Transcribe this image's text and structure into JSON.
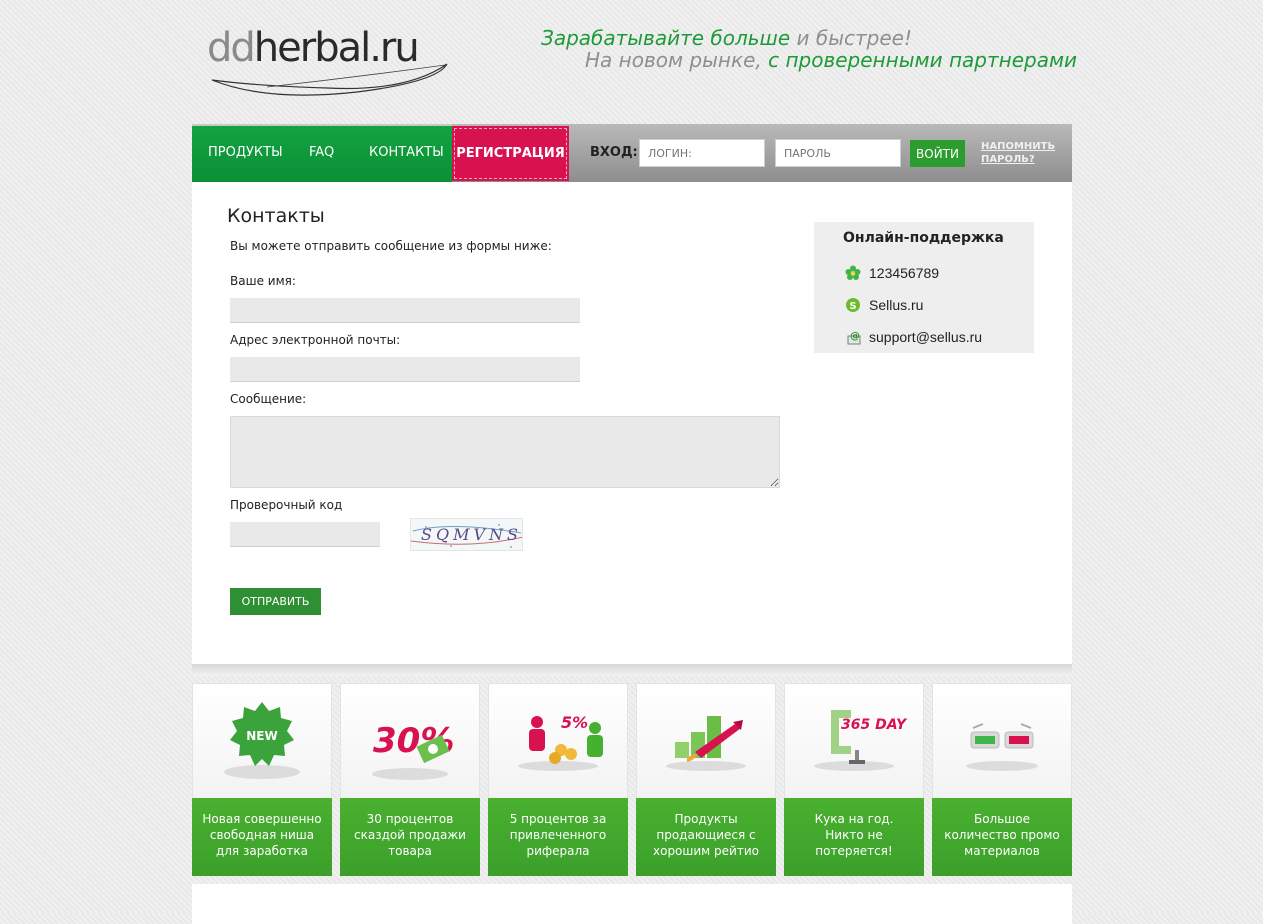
{
  "logo": {
    "text_gray": "dd",
    "text_dark": "herbal",
    "text_tld": ".ru"
  },
  "slogan": {
    "line1_green": "Зарабатывайте больше",
    "line1_gray": " и быстрее!",
    "line2_gray": "На новом рынке,",
    "line2_green": " с проверенными партнерами"
  },
  "nav": {
    "items": [
      "ПРОДУКТЫ",
      "FAQ",
      "КОНТАКТЫ"
    ],
    "register": "РЕГИСТРАЦИЯ",
    "login_label": "ВХОД:",
    "login_placeholder": "ЛОГИН:",
    "password_placeholder": "ПАРОЛЬ",
    "enter_button": "ВОЙТИ",
    "remind_line1": "НАПОМНИТЬ",
    "remind_line2": "ПАРОЛЬ?"
  },
  "contacts": {
    "title": "Контакты",
    "intro": "Вы можете отправить сообщение из формы ниже:",
    "name_label": "Ваше имя:",
    "email_label": "Адрес электронной почты:",
    "message_label": "Сообщение:",
    "captcha_label": "Проверочный код",
    "captcha_text": "SQMVNS",
    "send_button": "ОТПРАВИТЬ",
    "name_value": "",
    "email_value": "",
    "message_value": "",
    "captcha_value": ""
  },
  "support": {
    "title": "Онлайн-поддержка",
    "icq": "123456789",
    "skype": "Sellus.ru",
    "email": "support@sellus.ru"
  },
  "features": [
    {
      "badge": "NEW",
      "caption_lines": [
        "Новая совершенно",
        "свободная ниша",
        "для заработка"
      ]
    },
    {
      "badge": "30%",
      "caption_lines": [
        "30 процентов",
        "сказдой продажи",
        "товара"
      ]
    },
    {
      "badge": "5%",
      "caption_lines": [
        "5 процентов за",
        "привлеченного",
        "риферала"
      ]
    },
    {
      "badge": "",
      "caption_lines": [
        "Продукты",
        "продающиеся с",
        "хорошим рейтио"
      ]
    },
    {
      "badge": "365 DAY",
      "caption_lines": [
        "Кука на год.",
        "Никто не",
        "потеряется!"
      ]
    },
    {
      "badge": "",
      "caption_lines": [
        "Большое",
        "количество промо",
        "материалов"
      ]
    }
  ],
  "colors": {
    "brand_green": "#1e9a38",
    "nav_green": "#12a341",
    "register_pink": "#d8114f",
    "feature_green": "#45aa2e"
  }
}
